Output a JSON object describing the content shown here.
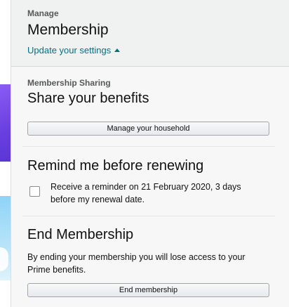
{
  "header": {
    "kicker": "Manage",
    "title": "Membership",
    "settings_link": "Update your settings"
  },
  "sharing": {
    "kicker": "Membership Sharing",
    "title": "Share your benefits",
    "button_label": "Manage your household"
  },
  "reminder": {
    "title": "Remind me before renewing",
    "checkbox_label": "Receive a reminder on 21 February 2020, 3 days before my renewal date.",
    "checked": false
  },
  "end_membership": {
    "title": "End Membership",
    "description": "By ending your membership you will lose access to your Prime benefits.",
    "button_label": "End membership"
  },
  "colors": {
    "link": "#007185",
    "header_bg": "#f0f2f2",
    "panel_bg": "#f7f7f7"
  },
  "icons": {
    "settings_link_caret": "caret-up-icon"
  }
}
